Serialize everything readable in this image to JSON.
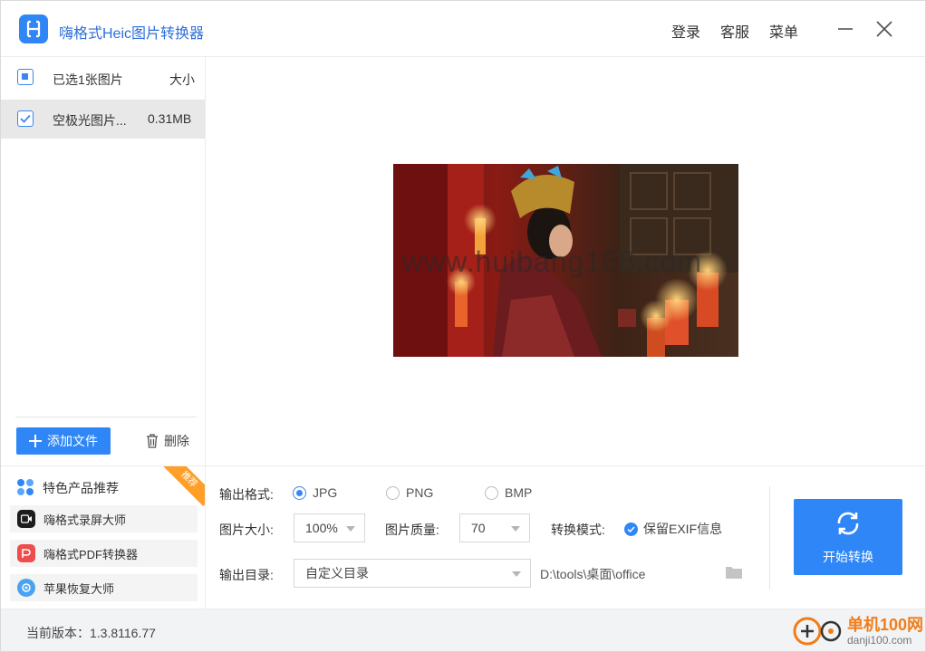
{
  "app": {
    "title": "嗨格式Heic图片转换器",
    "nav": {
      "login": "登录",
      "service": "客服",
      "menu": "菜单"
    }
  },
  "file_list": {
    "header": {
      "selected_label": "已选1张图片",
      "size_column": "大小"
    },
    "rows": [
      {
        "name": "空极光图片...",
        "size": "0.31MB",
        "checked": true
      }
    ],
    "add_button": "添加文件",
    "delete_button": "删除"
  },
  "preview": {
    "watermark": "www.huibang168.com"
  },
  "promo": {
    "title": "特色产品推荐",
    "badge": "推荐",
    "items": [
      {
        "label": "嗨格式录屏大师",
        "icon": "screen-recorder-icon"
      },
      {
        "label": "嗨格式PDF转换器",
        "icon": "pdf-converter-icon"
      },
      {
        "label": "苹果恢复大师",
        "icon": "apple-recovery-icon"
      }
    ]
  },
  "settings": {
    "output_format_label": "输出格式:",
    "formats": [
      {
        "label": "JPG",
        "selected": true
      },
      {
        "label": "PNG",
        "selected": false
      },
      {
        "label": "BMP",
        "selected": false
      }
    ],
    "image_size_label": "图片大小:",
    "image_size_value": "100%",
    "image_quality_label": "图片质量:",
    "image_quality_value": "70",
    "convert_mode_label": "转换模式:",
    "keep_exif_label": "保留EXIF信息",
    "keep_exif_checked": true,
    "output_dir_label": "输出目录:",
    "output_dir_value": "自定义目录",
    "output_path": "D:\\tools\\桌面\\office",
    "start_button": "开始转换"
  },
  "footer": {
    "version": "当前版本：1.3.8116.77",
    "site_name": "单机100网",
    "site_url": "danji100.com"
  },
  "colors": {
    "accent": "#2f86f6",
    "title_text": "#2f6fd6",
    "badge": "#ff9f2a",
    "selected_row": "#e8e8e8"
  }
}
